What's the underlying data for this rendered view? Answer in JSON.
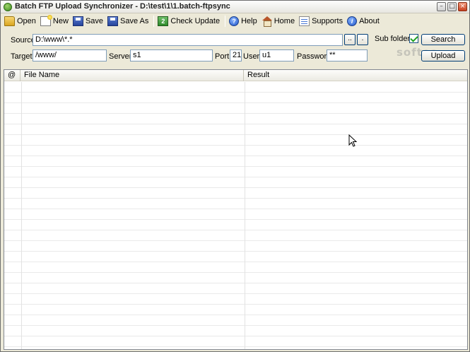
{
  "window": {
    "title": "Batch FTP Upload Synchronizer - D:\\test\\1\\1.batch-ftpsync",
    "minimize_glyph": "–",
    "maximize_glyph": "□",
    "close_glyph": "×"
  },
  "toolbar": {
    "open_label": "Open",
    "new_label": "New",
    "save_label": "Save",
    "saveas_label": "Save As",
    "check_update_label": "Check Update",
    "help_label": "Help",
    "home_label": "Home",
    "supports_label": "Supports",
    "about_label": "About"
  },
  "form": {
    "source_label": "Source",
    "source_value": "D:\\www\\*.*",
    "browse_btn_1": "..",
    "browse_btn_2": ".",
    "subfolders_label": "Sub folders",
    "subfolders_checked": true,
    "search_label": "Search",
    "target_label": "Target",
    "target_value": "/www/",
    "server_label": "Server",
    "server_value": "s1",
    "port_label": "Port",
    "port_value": "21",
    "user_label": "User",
    "user_value": "u1",
    "password_label": "Password",
    "password_value": "**",
    "upload_label": "Upload"
  },
  "watermark": "softea",
  "grid": {
    "columns": [
      "@",
      "File Name",
      "Result"
    ],
    "rows": []
  }
}
